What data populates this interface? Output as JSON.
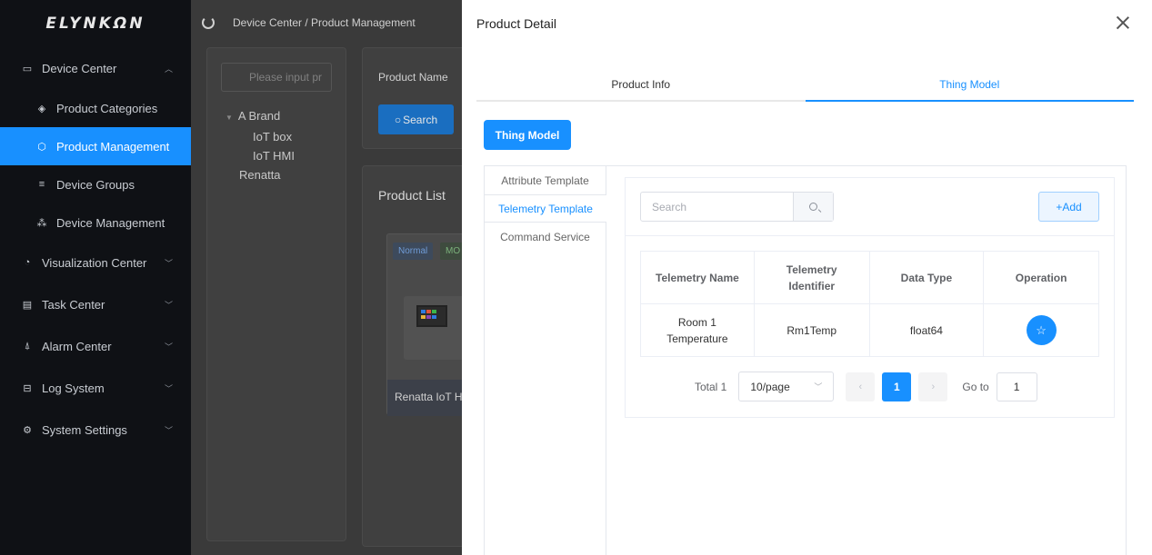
{
  "sidebar": {
    "logo": "ELYNKΩN",
    "items": [
      {
        "label": "Device Center",
        "icon": "monitor-icon"
      },
      {
        "label": "Product Categories",
        "icon": "layers-icon"
      },
      {
        "label": "Product Management",
        "icon": "cube-icon"
      },
      {
        "label": "Device Groups",
        "icon": "list-icon"
      },
      {
        "label": "Device Management",
        "icon": "nodes-icon"
      },
      {
        "label": "Visualization Center",
        "icon": "eye-icon"
      },
      {
        "label": "Task Center",
        "icon": "clipboard-icon"
      },
      {
        "label": "Alarm Center",
        "icon": "alarm-icon"
      },
      {
        "label": "Log System",
        "icon": "log-icon"
      },
      {
        "label": "System Settings",
        "icon": "gear-icon"
      }
    ]
  },
  "header": {
    "breadcrumb": "Device Center / Product Management"
  },
  "background": {
    "search_placeholder": "Please input pr",
    "tree": [
      "A Brand",
      "IoT box",
      "IoT HMI",
      "Renatta"
    ],
    "product_name_label": "Product Name",
    "search_button": "Search",
    "product_list_title": "Product List",
    "card_tag_normal": "Normal",
    "card_tag_mo": "MO",
    "card_name": "Renatta IoT H"
  },
  "drawer": {
    "title": "Product Detail",
    "tabs": [
      "Product Info",
      "Thing Model"
    ],
    "thing_model_button": "Thing Model",
    "side_tabs": [
      "Attribute Template",
      "Telemetry Template",
      "Command Service"
    ],
    "search_placeholder": "Search",
    "add_button": "+Add",
    "table": {
      "headers": [
        "Telemetry Name",
        "Telemetry Identifier",
        "Data Type",
        "Operation"
      ],
      "rows": [
        {
          "name": "Room 1 Temperature",
          "identifier": "Rm1Temp",
          "type": "float64"
        }
      ]
    },
    "pagination": {
      "total": "Total 1",
      "page_size": "10/page",
      "current": "1",
      "goto_label": "Go to",
      "goto_value": "1"
    }
  },
  "colors": {
    "accent": "#1890ff",
    "sidebar_bg": "#0f1115"
  }
}
